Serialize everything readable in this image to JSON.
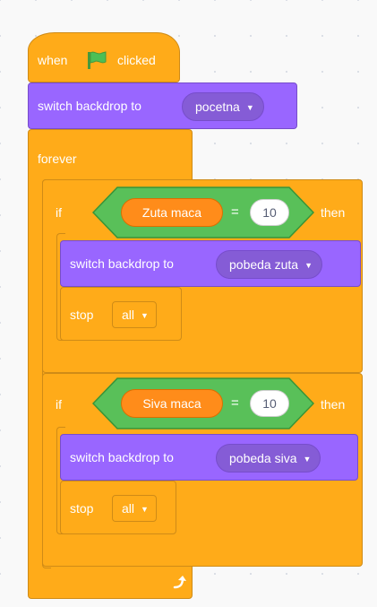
{
  "blocks": {
    "hat": {
      "text_when": "when",
      "text_clicked": "clicked",
      "icon": "green-flag-icon"
    },
    "switch1": {
      "label": "switch backdrop to",
      "value": "pocetna"
    },
    "forever": {
      "label": "forever",
      "icon": "loop-arrow-icon"
    },
    "if1": {
      "if_label": "if",
      "variable": "Zuta maca",
      "operator": "=",
      "compare_value": "10",
      "then_label": "then",
      "switch": {
        "label": "switch backdrop to",
        "value": "pobeda zuta"
      },
      "stop": {
        "label": "stop",
        "value": "all"
      }
    },
    "if2": {
      "if_label": "if",
      "variable": "Siva maca",
      "operator": "=",
      "compare_value": "10",
      "then_label": "then",
      "switch": {
        "label": "switch backdrop to",
        "value": "pobeda siva"
      },
      "stop": {
        "label": "stop",
        "value": "all"
      }
    }
  },
  "colors": {
    "control": "#ffab19",
    "looks": "#9966ff",
    "operators": "#59c059",
    "variables": "#ff8c1a",
    "flag": "#4cbf56"
  }
}
